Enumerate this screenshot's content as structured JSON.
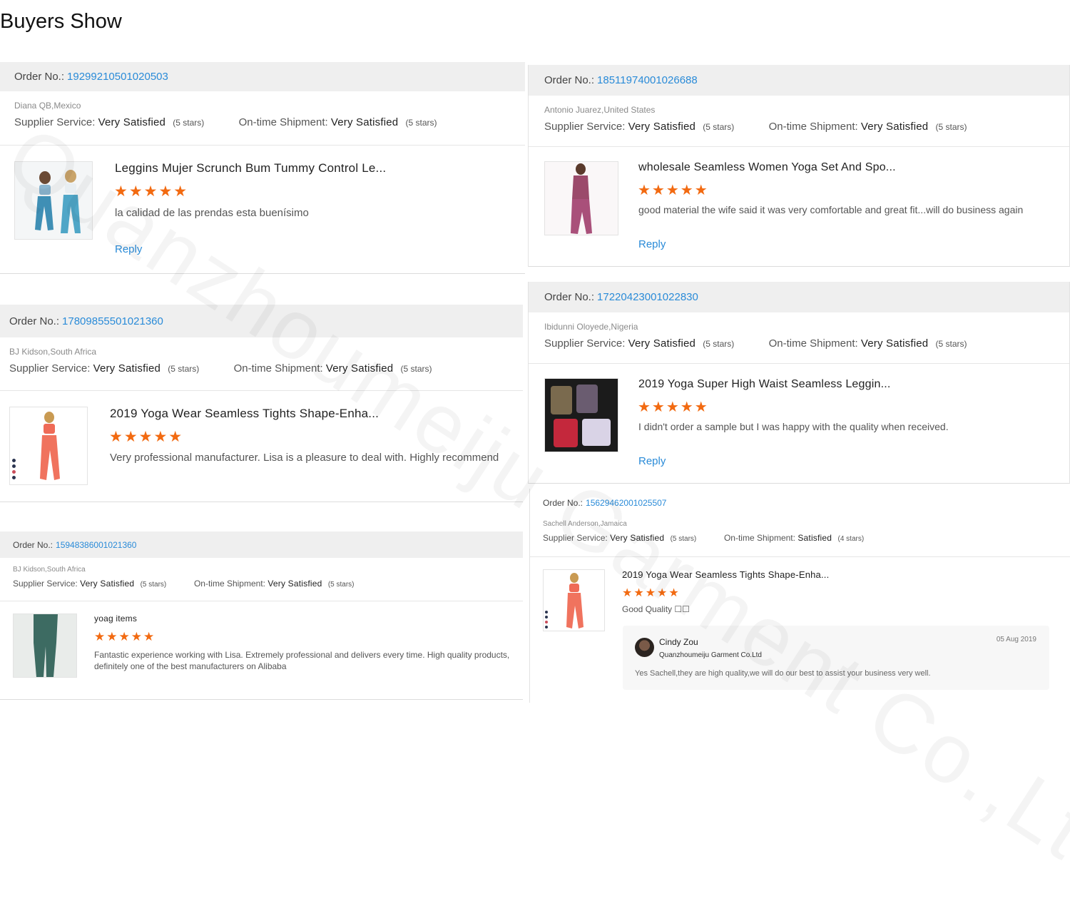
{
  "page": {
    "title": "Buyers Show"
  },
  "labels": {
    "order_no": "Order No.:",
    "supplier_service": "Supplier Service:",
    "ontime_shipment": "On-time Shipment:",
    "reply": "Reply"
  },
  "watermark": "Quanzhoumeiju Garment Co.,Ltd",
  "colors": {
    "accent": "#2a8bd8",
    "star": "#f26a11",
    "header_bg": "#efefef"
  },
  "reviews": [
    {
      "order_no": "19299210501020503",
      "buyer": "Diana QB,Mexico",
      "supplier_rating": "Very Satisfied",
      "supplier_stars": "(5 stars)",
      "shipment_rating": "Very Satisfied",
      "shipment_stars": "(5 stars)",
      "product_title": "Leggins Mujer Scrunch Bum Tummy Control Le...",
      "rating": 5,
      "stars": "★★★★★",
      "comment": "la calidad de las prendas esta buenísimo",
      "reply_link": "Reply",
      "image": "two-women-teal-leggings"
    },
    {
      "order_no": "17809855501021360",
      "buyer": "BJ Kidson,South Africa",
      "supplier_rating": "Very Satisfied",
      "supplier_stars": "(5 stars)",
      "shipment_rating": "Very Satisfied",
      "shipment_stars": "(5 stars)",
      "product_title": "2019 Yoga Wear Seamless Tights Shape-Enha...",
      "rating": 5,
      "stars": "★★★★★",
      "comment": "Very professional manufacturer. Lisa is a pleasure to deal with. Highly recommend",
      "image": "woman-coral-yoga-set"
    },
    {
      "order_no": "15948386001021360",
      "buyer": "BJ Kidson,South Africa",
      "supplier_rating": "Very Satisfied",
      "supplier_stars": "(5 stars)",
      "shipment_rating": "Very Satisfied",
      "shipment_stars": "(5 stars)",
      "product_title": "yoag items",
      "rating": 5,
      "stars": "★★★★★",
      "comment": "Fantastic experience working with Lisa. Extremely professional and delivers every time. High quality products, definitely one of the best manufacturers on Alibaba",
      "image": "green-leggings-legs"
    },
    {
      "order_no": "18511974001026688",
      "buyer": "Antonio Juarez,United States",
      "supplier_rating": "Very Satisfied",
      "supplier_stars": "(5 stars)",
      "shipment_rating": "Very Satisfied",
      "shipment_stars": "(5 stars)",
      "product_title": "wholesale Seamless Women Yoga Set And Spo...",
      "rating": 5,
      "stars": "★★★★★",
      "comment": "good material the wife said it was very comfortable and great fit...will do business again",
      "reply_link": "Reply",
      "image": "woman-maroon-yoga-set"
    },
    {
      "order_no": "17220423001022830",
      "buyer": "Ibidunni Oloyede,Nigeria",
      "supplier_rating": "Very Satisfied",
      "supplier_stars": "(5 stars)",
      "shipment_rating": "Very Satisfied",
      "shipment_stars": "(5 stars)",
      "product_title": "2019 Yoga Super High Waist Seamless Leggin...",
      "rating": 5,
      "stars": "★★★★★",
      "comment": "I didn't order a sample but I was happy with the quality when received.",
      "reply_link": "Reply",
      "image": "folded-leggings-assorted"
    },
    {
      "order_no": "15629462001025507",
      "buyer": "Sachell Anderson,Jamaica",
      "supplier_rating": "Very Satisfied",
      "supplier_stars": "(5 stars)",
      "shipment_rating": "Satisfied",
      "shipment_stars": "(4 stars)",
      "product_title": "2019 Yoga Wear Seamless Tights Shape-Enha...",
      "rating": 5,
      "stars": "★★★★★",
      "comment": "Good Quality ☐☐",
      "image": "woman-coral-yoga-set",
      "seller_reply": {
        "name": "Cindy Zou",
        "company": "Quanzhoumeiju Garment Co.Ltd",
        "date": "05 Aug 2019",
        "text": "Yes Sachell,they are high quality,we will do our best to assist your business very well."
      }
    }
  ]
}
